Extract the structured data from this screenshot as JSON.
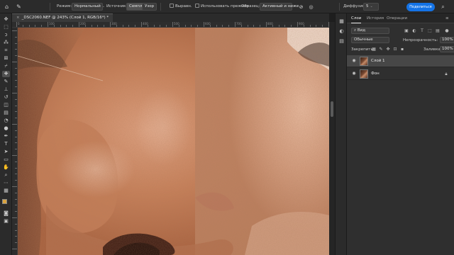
{
  "options_bar": {
    "mode_label": "Режим:",
    "mode_value": "Нормальный",
    "source_label": "Источник:",
    "source_sampled": "Семпл.",
    "source_pattern": "Узор",
    "align_label": "Выравн.",
    "use_legacy_label": "Использовать прежние",
    "sample_label": "Образец:",
    "sample_value": "Активный и ниже",
    "diffusion_label": "Диффузия:",
    "diffusion_value": "5",
    "share_label": "Поделиться"
  },
  "document": {
    "tab_title": "_DSC2060.NEF @ 243% (Слой 1, RGB/16*) *",
    "close_symbol": "×"
  },
  "rulers": {
    "top_labels": [
      "0",
      "100",
      "200",
      "300",
      "400",
      "500",
      "600",
      "700",
      "800",
      "900"
    ]
  },
  "panels": {
    "tabs": [
      "Слои",
      "История",
      "Операции"
    ],
    "active_tab": "Слои",
    "filter_value": "Вид",
    "blend_mode": "Обычные",
    "opacity_label": "Непрозрачность:",
    "opacity_value": "100%",
    "lock_label": "Закрепить:",
    "fill_label": "Заливка:",
    "fill_value": "100%",
    "layers": [
      {
        "name": "Слой 1",
        "selected": true,
        "locked": false
      },
      {
        "name": "Фон",
        "selected": false,
        "locked": true
      }
    ]
  },
  "icons": {
    "home": "home-icon",
    "brush": "brush-icon",
    "eye": "eye-icon",
    "lock": "lock-icon",
    "search": "search-icon"
  },
  "colors": {
    "accent": "#1473e6",
    "foreground_swatch": "#d9a441",
    "background_swatch": "#ffffff"
  }
}
